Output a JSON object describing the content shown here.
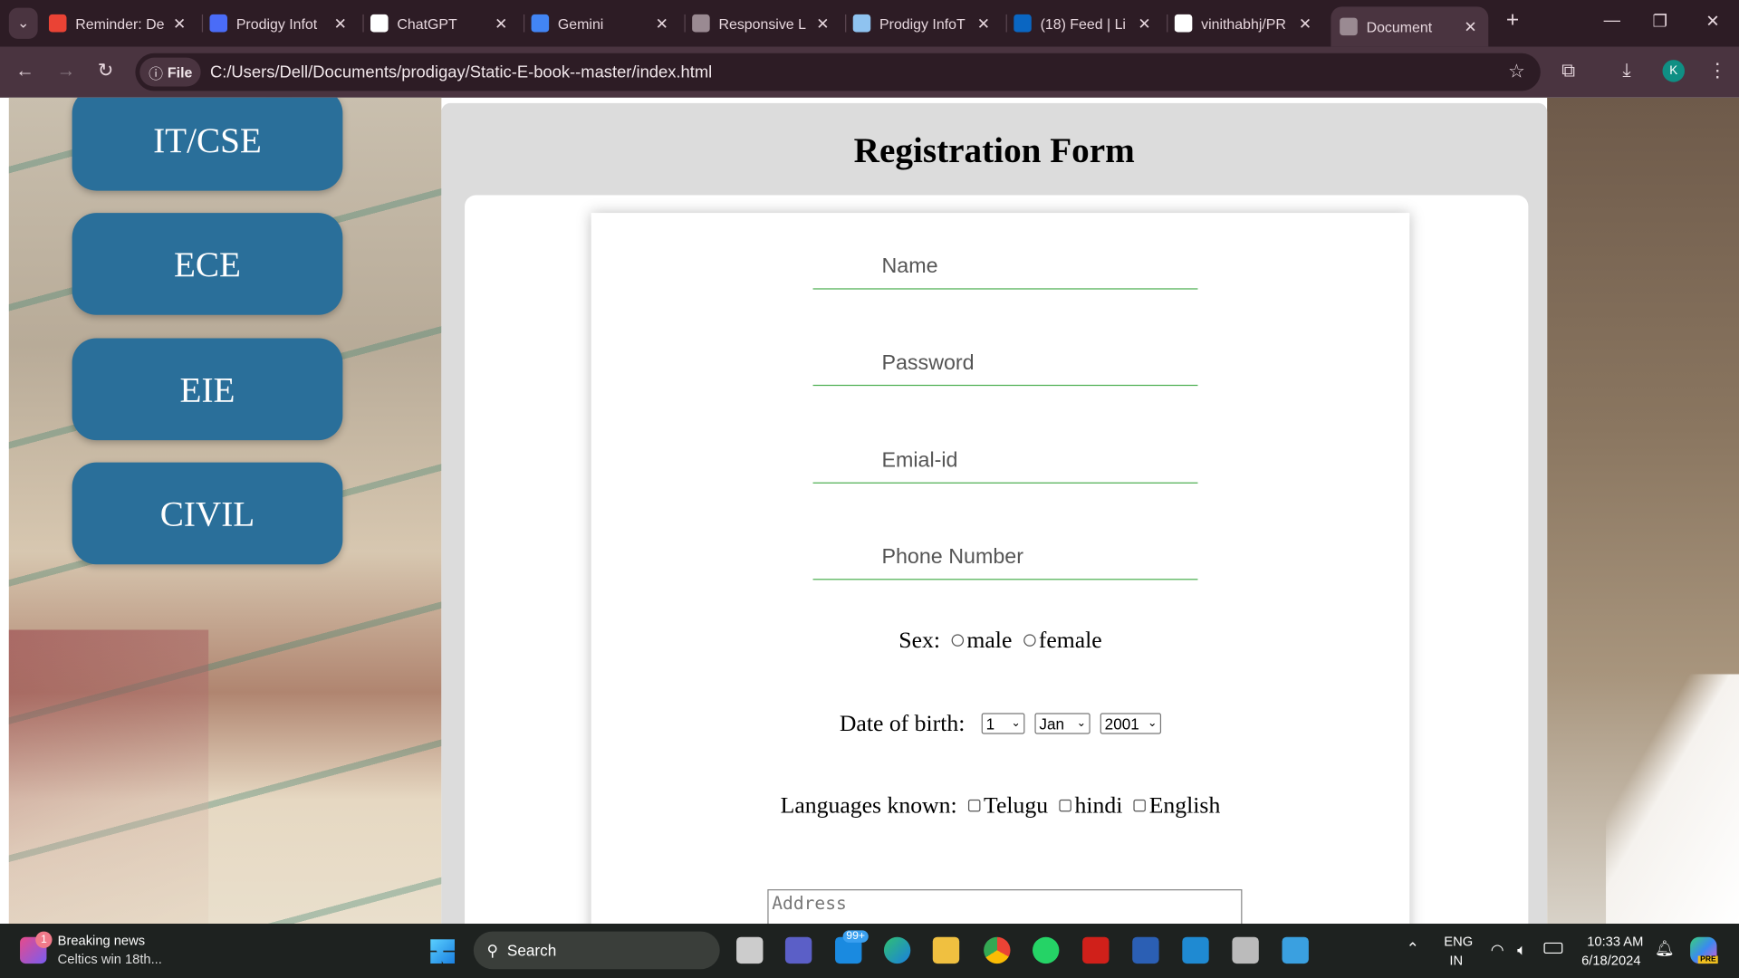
{
  "browser": {
    "tabs": [
      {
        "title": "Reminder: De",
        "icon": "gmail-icon",
        "color": "#ea4335"
      },
      {
        "title": "Prodigy Infot",
        "icon": "canva-icon",
        "color": "#4a6cf7"
      },
      {
        "title": "ChatGPT",
        "icon": "chatgpt-icon",
        "color": "#ffffff"
      },
      {
        "title": "Gemini",
        "icon": "gemini-icon",
        "color": "#4285f4"
      },
      {
        "title": "Responsive L",
        "icon": "globe-icon",
        "color": "#9a8a92"
      },
      {
        "title": "Prodigy InfoT",
        "icon": "bulb-icon",
        "color": "#8fc3f0"
      },
      {
        "title": "(18) Feed | Li",
        "icon": "linkedin-icon",
        "color": "#0a66c2"
      },
      {
        "title": "vinithabhj/PR",
        "icon": "github-icon",
        "color": "#ffffff"
      },
      {
        "title": "Document",
        "icon": "globe-icon",
        "color": "#9a8a92"
      }
    ],
    "chip": "File",
    "url": "C:/Users/Dell/Documents/prodigay/Static-E-book--master/index.html",
    "profile": "K"
  },
  "sidebar": {
    "departments": [
      "IT/CSE",
      "ECE",
      "EIE",
      "CIVIL"
    ]
  },
  "form": {
    "title": "Registration Form",
    "name_placeholder": "Name",
    "password_placeholder": "Password",
    "email_placeholder": "Emial-id",
    "phone_placeholder": "Phone Number",
    "sex_label": "Sex:",
    "sex_options": [
      "male",
      "female"
    ],
    "dob_label": "Date of birth:",
    "dob_day": "1",
    "dob_month": "Jan",
    "dob_year": "2001",
    "lang_label": "Languages known:",
    "languages": [
      "Telugu",
      "hindi",
      "English"
    ],
    "address_placeholder": "Address"
  },
  "taskbar": {
    "news_title": "Breaking news",
    "news_text": "Celtics win 18th...",
    "news_badge": "1",
    "search": "Search",
    "mail_badge": "99+",
    "lang1": "ENG",
    "lang2": "IN",
    "time": "10:33 AM",
    "date": "6/18/2024",
    "copilot_badge": "PRE"
  }
}
